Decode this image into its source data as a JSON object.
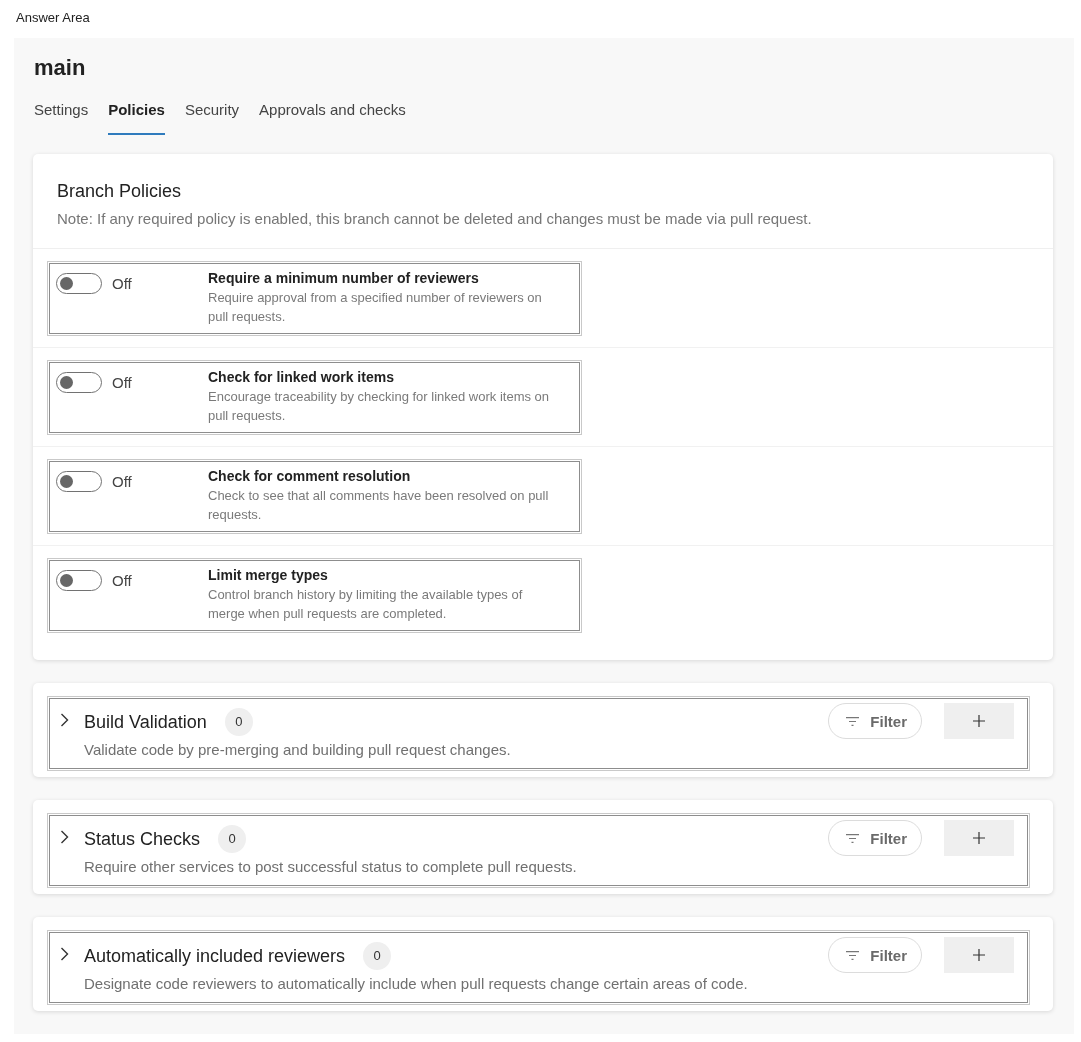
{
  "answer_area_label": "Answer Area",
  "page": {
    "title": "main"
  },
  "tabs": [
    {
      "label": "Settings",
      "selected": false
    },
    {
      "label": "Policies",
      "selected": true
    },
    {
      "label": "Security",
      "selected": false
    },
    {
      "label": "Approvals and checks",
      "selected": false
    }
  ],
  "branch_policies": {
    "title": "Branch Policies",
    "note": "Note: If any required policy is enabled, this branch cannot be deleted and changes must be made via pull request.",
    "policies": [
      {
        "title": "Require a minimum number of reviewers",
        "description": "Require approval from a specified number of reviewers on pull requests.",
        "on": false,
        "state_label": "Off"
      },
      {
        "title": "Check for linked work items",
        "description": "Encourage traceability by checking for linked work items on pull requests.",
        "on": false,
        "state_label": "Off"
      },
      {
        "title": "Check for comment resolution",
        "description": "Check to see that all comments have been resolved on pull requests.",
        "on": false,
        "state_label": "Off"
      },
      {
        "title": "Limit merge types",
        "description": "Control branch history by limiting the available types of merge when pull requests are completed.",
        "on": false,
        "state_label": "Off"
      }
    ]
  },
  "sections": [
    {
      "title": "Build Validation",
      "count": "0",
      "description": "Validate code by pre-merging and building pull request changes.",
      "expanded": false,
      "filter_label": "Filter"
    },
    {
      "title": "Status Checks",
      "count": "0",
      "description": "Require other services to post successful status to complete pull requests.",
      "expanded": false,
      "filter_label": "Filter"
    },
    {
      "title": "Automatically included reviewers",
      "count": "0",
      "description": "Designate code reviewers to automatically include when pull requests change certain areas of code.",
      "expanded": false,
      "filter_label": "Filter"
    }
  ]
}
